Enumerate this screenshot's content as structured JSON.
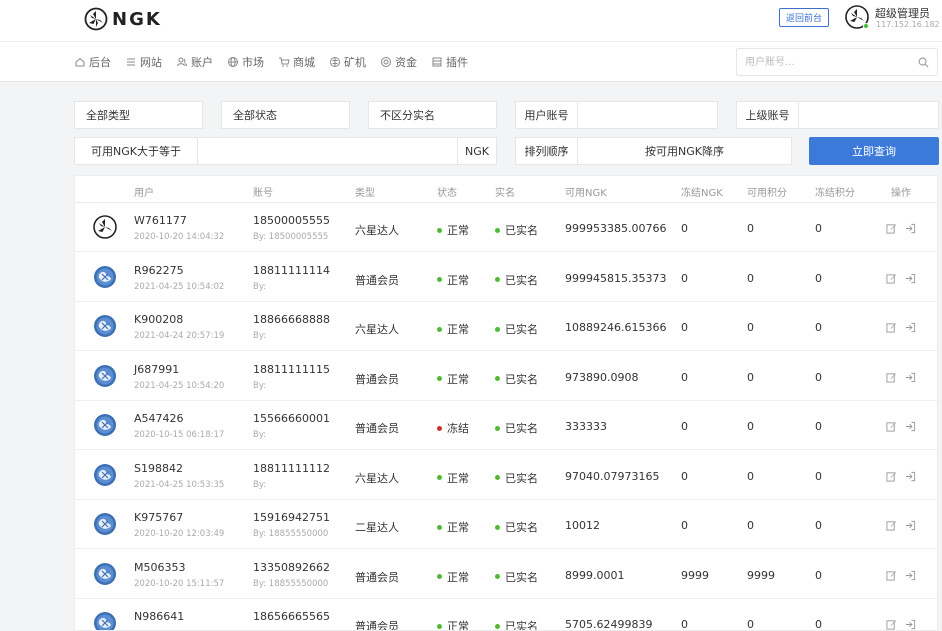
{
  "header": {
    "logo_text": "NGK",
    "back_label": "返回前台",
    "admin_name": "超级管理员",
    "admin_ip": "117.152.16.182"
  },
  "nav": {
    "items": [
      {
        "label": "后台",
        "icon": "home-icon"
      },
      {
        "label": "网站",
        "icon": "list-icon"
      },
      {
        "label": "账户",
        "icon": "users-icon"
      },
      {
        "label": "市场",
        "icon": "globe-icon"
      },
      {
        "label": "商城",
        "icon": "cart-icon"
      },
      {
        "label": "矿机",
        "icon": "mining-icon"
      },
      {
        "label": "资金",
        "icon": "coin-icon"
      },
      {
        "label": "插件",
        "icon": "plugin-icon"
      }
    ],
    "search_placeholder": "用户账号..."
  },
  "filters": {
    "type": "全部类型",
    "status": "全部状态",
    "realname": "不区分实名",
    "account_label": "用户账号",
    "account_value": "",
    "parent_label": "上级账号",
    "parent_value": "",
    "ngk_label": "可用NGK大于等于",
    "ngk_value": "",
    "ngk_unit": "NGK",
    "sort_label": "排列顺序",
    "sort_value": "按可用NGK降序",
    "search_label": "立即查询"
  },
  "table": {
    "columns": [
      "用户",
      "账号",
      "类型",
      "状态",
      "实名",
      "可用NGK",
      "冻结NGK",
      "可用积分",
      "冻结积分",
      "操作"
    ],
    "rows": [
      {
        "user": "W761177",
        "time": "2020-10-20 14:04:32",
        "account": "18500005555",
        "by": "By: 18500005555",
        "type": "六星达人",
        "status": "正常",
        "status_color": "#52b83a",
        "realname": "已实名",
        "ngk": "999953385.00766",
        "frozen_ngk": "0",
        "points": "0",
        "frozen_points": "0",
        "avatar": "ngk-logo"
      },
      {
        "user": "R962275",
        "time": "2021-04-25 10:54:02",
        "account": "18811111114",
        "by": "By:",
        "type": "普通会员",
        "status": "正常",
        "status_color": "#52b83a",
        "realname": "已实名",
        "ngk": "999945815.35373",
        "frozen_ngk": "0",
        "points": "0",
        "frozen_points": "0",
        "avatar": "globe"
      },
      {
        "user": "K900208",
        "time": "2021-04-24 20:57:19",
        "account": "18866668888",
        "by": "By:",
        "type": "六星达人",
        "status": "正常",
        "status_color": "#52b83a",
        "realname": "已实名",
        "ngk": "10889246.615366",
        "frozen_ngk": "0",
        "points": "0",
        "frozen_points": "0",
        "avatar": "globe"
      },
      {
        "user": "J687991",
        "time": "2021-04-25 10:54:20",
        "account": "18811111115",
        "by": "By:",
        "type": "普通会员",
        "status": "正常",
        "status_color": "#52b83a",
        "realname": "已实名",
        "ngk": "973890.0908",
        "frozen_ngk": "0",
        "points": "0",
        "frozen_points": "0",
        "avatar": "globe"
      },
      {
        "user": "A547426",
        "time": "2020-10-15 06:18:17",
        "account": "15566660001",
        "by": "By:",
        "type": "普通会员",
        "status": "冻结",
        "status_color": "#c8322f",
        "realname": "已实名",
        "ngk": "333333",
        "frozen_ngk": "0",
        "points": "0",
        "frozen_points": "0",
        "avatar": "globe"
      },
      {
        "user": "S198842",
        "time": "2021-04-25 10:53:35",
        "account": "18811111112",
        "by": "By:",
        "type": "六星达人",
        "status": "正常",
        "status_color": "#52b83a",
        "realname": "已实名",
        "ngk": "97040.07973165",
        "frozen_ngk": "0",
        "points": "0",
        "frozen_points": "0",
        "avatar": "globe"
      },
      {
        "user": "K975767",
        "time": "2020-10-20 12:03:49",
        "account": "15916942751",
        "by": "By: 18855550000",
        "type": "二星达人",
        "status": "正常",
        "status_color": "#52b83a",
        "realname": "已实名",
        "ngk": "10012",
        "frozen_ngk": "0",
        "points": "0",
        "frozen_points": "0",
        "avatar": "globe"
      },
      {
        "user": "M506353",
        "time": "2020-10-20 15:11:57",
        "account": "13350892662",
        "by": "By: 18855550000",
        "type": "普通会员",
        "status": "正常",
        "status_color": "#52b83a",
        "realname": "已实名",
        "ngk": "8999.0001",
        "frozen_ngk": "9999",
        "points": "9999",
        "frozen_points": "0",
        "avatar": "globe"
      },
      {
        "user": "N986641",
        "time": "",
        "account": "18656665565",
        "by": "",
        "type": "普通会员",
        "status": "正常",
        "status_color": "#52b83a",
        "realname": "已实名",
        "ngk": "5705.62499839",
        "frozen_ngk": "0",
        "points": "0",
        "frozen_points": "0",
        "avatar": "globe"
      }
    ]
  },
  "colors": {
    "accent": "#3b7ad8",
    "ok": "#52b83a",
    "frozen": "#c8322f"
  }
}
